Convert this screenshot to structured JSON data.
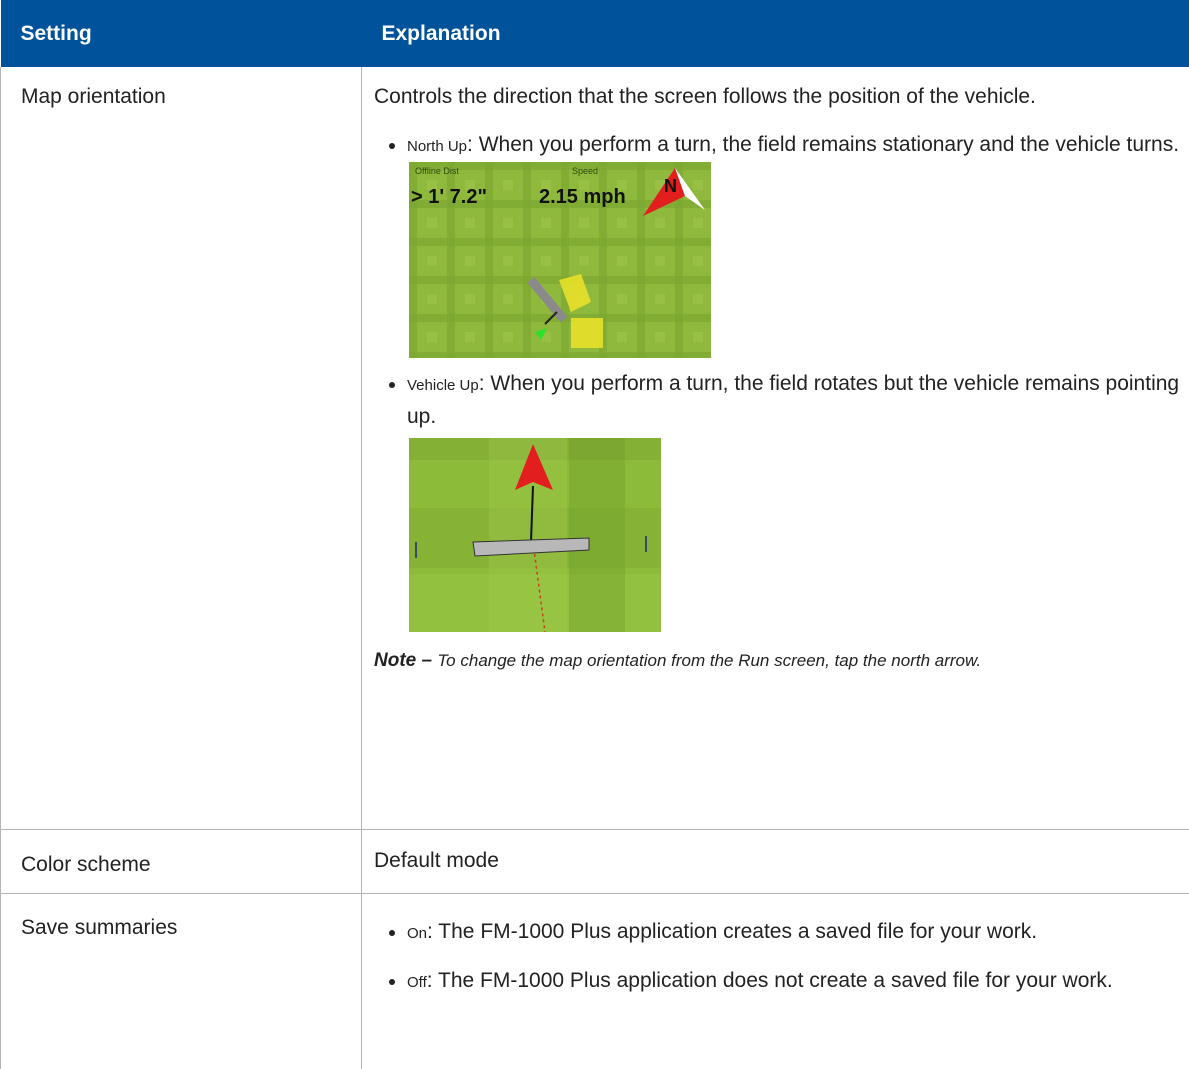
{
  "header": {
    "setting": "Setting",
    "explanation": "Explanation"
  },
  "rows": [
    {
      "setting": "Map orientation",
      "intro": "Controls the direction that the screen follows the position of the vehicle.",
      "options": [
        {
          "name": "North Up",
          "text": ": When you perform a turn, the field remains stationary and the vehicle turns."
        },
        {
          "name": "Vehicle Up",
          "text": ": When you perform a turn, the field rotates but the vehicle remains pointing up."
        }
      ],
      "north_up_shot": {
        "offline_label": "Offline Dist",
        "offline_value": "> 1' 7.2\"",
        "speed_label": "Speed",
        "speed_value": "2.15 mph",
        "north_letter": "N"
      },
      "note": {
        "label": "Note",
        "dash": " – ",
        "text": "To change the map orientation from the Run screen, tap the north arrow."
      }
    },
    {
      "setting": "Color scheme",
      "text": "Default mode"
    },
    {
      "setting": "Save summaries",
      "options": [
        {
          "name": "On",
          "text": ": The FM-1000 Plus application creates a saved file for your work."
        },
        {
          "name": "Off",
          "text": ": The FM-1000 Plus application does not create a saved file for your work."
        }
      ]
    }
  ],
  "colors": {
    "header_bg": "#00539b",
    "header_text": "#ffffff",
    "border": "#b4b4b4",
    "grass_light": "#8cb83a",
    "grass_dark": "#6e9a28",
    "arrow_red": "#e21e1e"
  }
}
